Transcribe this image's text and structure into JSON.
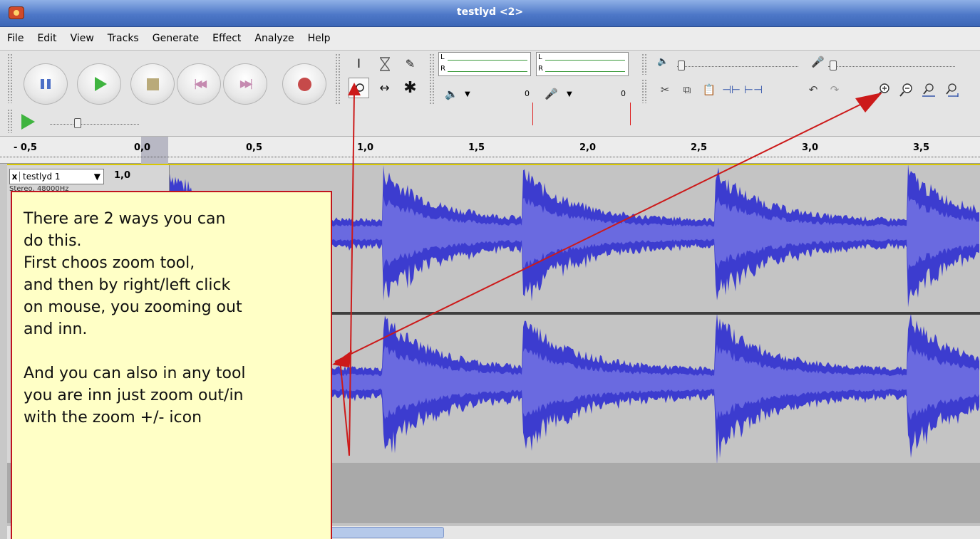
{
  "window": {
    "title": "testlyd <2>"
  },
  "menu": [
    "File",
    "Edit",
    "View",
    "Tracks",
    "Generate",
    "Effect",
    "Analyze",
    "Help"
  ],
  "meters": {
    "play_left_letter": "L",
    "play_right_letter": "R",
    "rec_left_letter": "L",
    "rec_right_letter": "R",
    "play_value": "0",
    "rec_value": "0"
  },
  "ruler": {
    "ticks": [
      "- 0,5",
      "0,0",
      "0,5",
      "1,0",
      "1,5",
      "2,0",
      "2,5",
      "3,0",
      "3,5"
    ]
  },
  "track": {
    "close": "x",
    "name": "testlyd 1",
    "dropdown": "▼",
    "gain": "1,0",
    "format": "Stereo, 48000Hz"
  },
  "annotation": {
    "text": "There are 2 ways you can\ndo this.\nFirst choos zoom tool,\nand then by right/left click\non mouse, you zooming out\nand inn.\n\nAnd you can also in any tool\nyou are inn just zoom out/in\nwith the zoom +/- icon"
  },
  "colors": {
    "waveform_dark": "#3c3ccf",
    "waveform_light": "#6a6ae0",
    "annotation_bg": "#ffffc6",
    "annotation_border": "#c0141e",
    "arrow": "#cc1a1a"
  },
  "icons": {
    "pause": "pause-icon",
    "play": "play-icon",
    "stop": "stop-icon",
    "skip_start": "skip-to-start-icon",
    "skip_end": "skip-to-end-icon",
    "record": "record-icon",
    "zoom_in": "zoom-in-icon",
    "zoom_out": "zoom-out-icon"
  }
}
